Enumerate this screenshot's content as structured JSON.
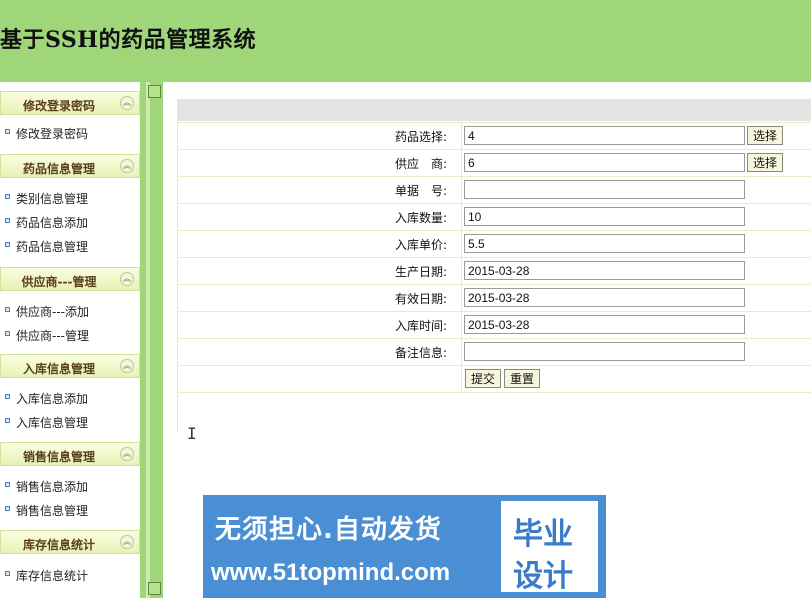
{
  "header": {
    "title": "基于SSH的药品管理系统"
  },
  "sidebar": {
    "collapse_glyph": "︽",
    "groups": [
      {
        "title": "修改登录密码",
        "items": [
          "修改登录密码"
        ]
      },
      {
        "title": "药品信息管理",
        "items": [
          "类别信息管理",
          "药品信息添加",
          "药品信息管理"
        ]
      },
      {
        "title": "供应商---管理",
        "items": [
          "供应商---添加",
          "供应商---管理"
        ]
      },
      {
        "title": "入库信息管理",
        "items": [
          "入库信息添加",
          "入库信息管理"
        ]
      },
      {
        "title": "销售信息管理",
        "items": [
          "销售信息添加",
          "销售信息管理"
        ]
      },
      {
        "title": "库存信息统计",
        "items": [
          "库存信息统计"
        ]
      }
    ]
  },
  "form": {
    "fields": [
      {
        "label": "药品选择:",
        "value": "4",
        "button": "选择"
      },
      {
        "label": "供应　商:",
        "value": "6",
        "button": "选择"
      },
      {
        "label": "单据　号:",
        "value": ""
      },
      {
        "label": "入库数量:",
        "value": "10"
      },
      {
        "label": "入库单价:",
        "value": "5.5"
      },
      {
        "label": "生产日期:",
        "value": "2015-03-28"
      },
      {
        "label": "有效日期:",
        "value": "2015-03-28"
      },
      {
        "label": "入库时间:",
        "value": "2015-03-28"
      },
      {
        "label": "备注信息:",
        "value": ""
      }
    ],
    "submit_label": "提交",
    "reset_label": "重置"
  },
  "cursor": {
    "glyph": "I"
  },
  "watermark": {
    "line1": "无须担心.自动发货",
    "line2": "www.51topmind.com",
    "box_line1": "毕业",
    "box_line2": "设计"
  },
  "colors": {
    "header_bg": "#9fd67a",
    "menu_title": "#5a3e1b",
    "watermark_bg": "#4a8fd4"
  }
}
